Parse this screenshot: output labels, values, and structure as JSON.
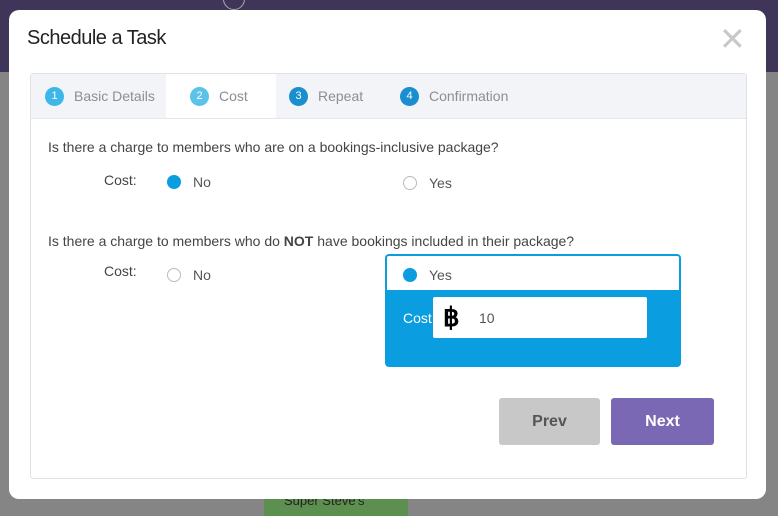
{
  "background": {
    "event_label": "Super Steve's"
  },
  "modal": {
    "title": "Schedule a Task",
    "close_icon": "close-icon"
  },
  "steps": [
    {
      "num": "1",
      "label": "Basic Details",
      "color": "#3fb6e8"
    },
    {
      "num": "2",
      "label": "Cost",
      "color": "#5bc3e8"
    },
    {
      "num": "3",
      "label": "Repeat",
      "color": "#1a8fd0"
    },
    {
      "num": "4",
      "label": "Confirmation",
      "color": "#1a8fd0"
    }
  ],
  "active_step": "Cost",
  "q1": {
    "text": "Is there a charge to members who are on a bookings-inclusive package?",
    "label": "Cost:",
    "options": [
      "No",
      "Yes"
    ],
    "selected": "No"
  },
  "q2": {
    "text_before": "Is there a charge to members who do ",
    "text_bold": "NOT",
    "text_after": " have bookings included in their package?",
    "label": "Cost:",
    "options": [
      "No",
      "Yes"
    ],
    "selected": "Yes",
    "cost_label": "Cost",
    "currency_symbol": "฿",
    "cost_value": "10"
  },
  "buttons": {
    "prev": "Prev",
    "next": "Next"
  },
  "colors": {
    "accent": "#0a9ee0",
    "next": "#7b68b5",
    "prev": "#c8c8c8"
  }
}
